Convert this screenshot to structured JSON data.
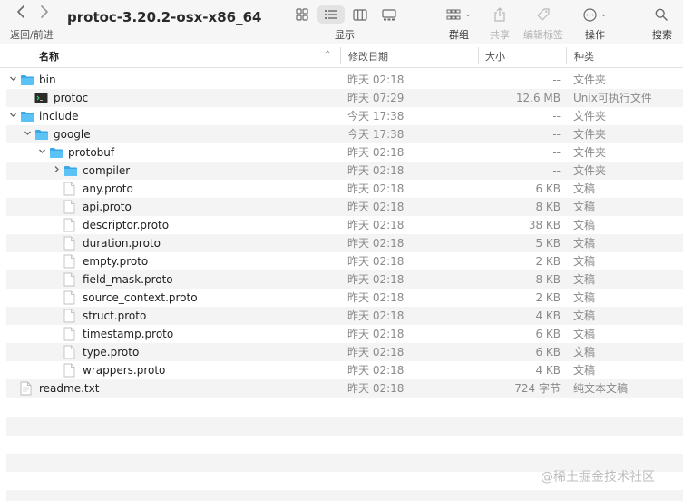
{
  "toolbar": {
    "back_icon": "chevron-left-icon",
    "forward_icon": "chevron-right-icon",
    "nav_label": "返回/前进",
    "title": "protoc-3.20.2-osx-x86_64",
    "view_label": "显示",
    "group_label": "群组",
    "share_label": "共享",
    "tags_label": "编辑标签",
    "action_label": "操作",
    "search_label": "搜索"
  },
  "columns": {
    "name": "名称",
    "date": "修改日期",
    "size": "大小",
    "kind": "种类"
  },
  "rows": [
    {
      "name": "bin",
      "date": "昨天 02:18",
      "size": "--",
      "kind": "文件夹",
      "type": "folder",
      "depth": 0,
      "disclosure": "open"
    },
    {
      "name": "protoc",
      "date": "昨天 07:29",
      "size": "12.6 MB",
      "kind": "Unix可执行文件",
      "type": "exec",
      "depth": 1,
      "disclosure": "none"
    },
    {
      "name": "include",
      "date": "今天 17:38",
      "size": "--",
      "kind": "文件夹",
      "type": "folder",
      "depth": 0,
      "disclosure": "open"
    },
    {
      "name": "google",
      "date": "今天 17:38",
      "size": "--",
      "kind": "文件夹",
      "type": "folder",
      "depth": 1,
      "disclosure": "open"
    },
    {
      "name": "protobuf",
      "date": "昨天 02:18",
      "size": "--",
      "kind": "文件夹",
      "type": "folder",
      "depth": 2,
      "disclosure": "open"
    },
    {
      "name": "compiler",
      "date": "昨天 02:18",
      "size": "--",
      "kind": "文件夹",
      "type": "folder",
      "depth": 3,
      "disclosure": "closed"
    },
    {
      "name": "any.proto",
      "date": "昨天 02:18",
      "size": "6 KB",
      "kind": "文稿",
      "type": "doc",
      "depth": 3,
      "disclosure": "none"
    },
    {
      "name": "api.proto",
      "date": "昨天 02:18",
      "size": "8 KB",
      "kind": "文稿",
      "type": "doc",
      "depth": 3,
      "disclosure": "none"
    },
    {
      "name": "descriptor.proto",
      "date": "昨天 02:18",
      "size": "38 KB",
      "kind": "文稿",
      "type": "doc",
      "depth": 3,
      "disclosure": "none"
    },
    {
      "name": "duration.proto",
      "date": "昨天 02:18",
      "size": "5 KB",
      "kind": "文稿",
      "type": "doc",
      "depth": 3,
      "disclosure": "none"
    },
    {
      "name": "empty.proto",
      "date": "昨天 02:18",
      "size": "2 KB",
      "kind": "文稿",
      "type": "doc",
      "depth": 3,
      "disclosure": "none"
    },
    {
      "name": "field_mask.proto",
      "date": "昨天 02:18",
      "size": "8 KB",
      "kind": "文稿",
      "type": "doc",
      "depth": 3,
      "disclosure": "none"
    },
    {
      "name": "source_context.proto",
      "date": "昨天 02:18",
      "size": "2 KB",
      "kind": "文稿",
      "type": "doc",
      "depth": 3,
      "disclosure": "none"
    },
    {
      "name": "struct.proto",
      "date": "昨天 02:18",
      "size": "4 KB",
      "kind": "文稿",
      "type": "doc",
      "depth": 3,
      "disclosure": "none"
    },
    {
      "name": "timestamp.proto",
      "date": "昨天 02:18",
      "size": "6 KB",
      "kind": "文稿",
      "type": "doc",
      "depth": 3,
      "disclosure": "none"
    },
    {
      "name": "type.proto",
      "date": "昨天 02:18",
      "size": "6 KB",
      "kind": "文稿",
      "type": "doc",
      "depth": 3,
      "disclosure": "none"
    },
    {
      "name": "wrappers.proto",
      "date": "昨天 02:18",
      "size": "4 KB",
      "kind": "文稿",
      "type": "doc",
      "depth": 3,
      "disclosure": "none"
    },
    {
      "name": "readme.txt",
      "date": "昨天 02:18",
      "size": "724 字节",
      "kind": "纯文本文稿",
      "type": "txt",
      "depth": 0,
      "disclosure": "none"
    }
  ],
  "colors": {
    "folder": "#5bc2f5",
    "folder_tab": "#3aa7e6",
    "alt_row": "#f4f4f4",
    "toolbar_bg": "#f6f6f6"
  },
  "watermark": "@稀土掘金技术社区"
}
